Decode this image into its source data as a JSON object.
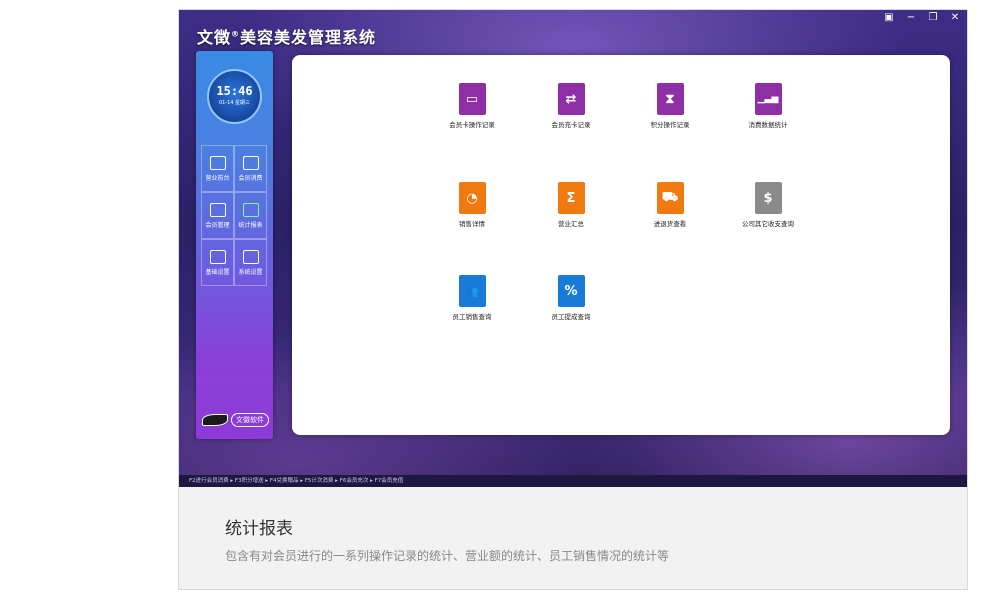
{
  "app": {
    "title": "文徴",
    "title_mark": "®",
    "title_rest": "美容美发管理系统",
    "window_controls": [
      "▣",
      "−",
      "❐",
      "✕"
    ]
  },
  "clock": {
    "time": "15:46",
    "date": "01-14 星期三"
  },
  "nav": [
    {
      "label": "营业前台",
      "icon": "monitor-icon"
    },
    {
      "label": "会员消费",
      "icon": "briefcase-icon"
    },
    {
      "label": "会员管理",
      "icon": "members-icon"
    },
    {
      "label": "统计报表",
      "icon": "bar-chart-icon",
      "active": true
    },
    {
      "label": "基础设置",
      "icon": "settings-icon"
    },
    {
      "label": "系统设置",
      "icon": "wrench-icon"
    }
  ],
  "brand": {
    "text": "文徽软件"
  },
  "tiles": [
    {
      "label": "会员卡操作记录",
      "color": "#8e2fa6",
      "glyph": "▭"
    },
    {
      "label": "会员充卡记录",
      "color": "#8e2fa6",
      "glyph": "⇄"
    },
    {
      "label": "积分操作记录",
      "color": "#8e2fa6",
      "glyph": "⧗"
    },
    {
      "label": "消费数据统计",
      "color": "#8e2fa6",
      "glyph": "▁▃▅"
    },
    {
      "label": "销售详情",
      "color": "#f07a10",
      "glyph": "◔"
    },
    {
      "label": "营业汇总",
      "color": "#f07a10",
      "glyph": "Σ"
    },
    {
      "label": "进退货查看",
      "color": "#f07a10",
      "glyph": "⛟"
    },
    {
      "label": "公司其它收支查询",
      "color": "#8a8a8a",
      "glyph": "$"
    },
    {
      "label": "员工销售查询",
      "color": "#1a7ad8",
      "glyph": "👥"
    },
    {
      "label": "员工提成查询",
      "color": "#1a7ad8",
      "glyph": "%"
    }
  ],
  "statusbar": {
    "text": "F2进行会员消费 ▸ F3积分增送 ▸ F4兑换赠品 ▸ F5计次消费 ▸ F6会员充次 ▸ F7会员充值"
  },
  "caption": {
    "title": "统计报表",
    "description": "包含有对会员进行的一系列操作记录的统计、营业额的统计、员工销售情况的统计等"
  }
}
